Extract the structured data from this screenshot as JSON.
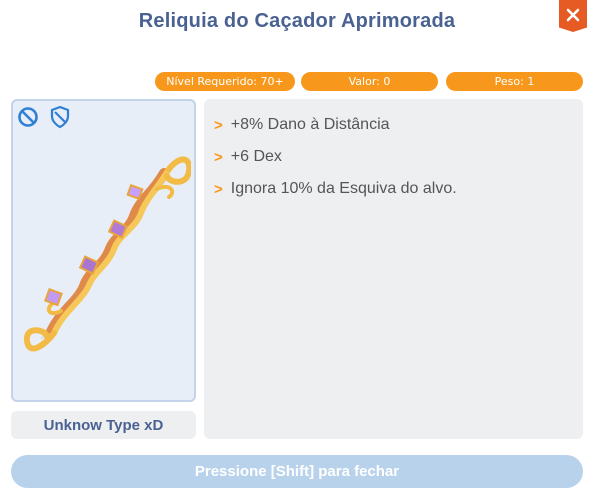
{
  "window": {
    "title": "Reliquia do Caçador Aprimorada",
    "close_icon": "close-icon"
  },
  "stats": {
    "required_level": "Nível Requerido: 70+",
    "value": "Valor: 0",
    "weight": "Peso: 1"
  },
  "item": {
    "image": "bow",
    "icons": [
      "no-trade-icon",
      "shield-icon"
    ],
    "type_label": "Unknow Type xD"
  },
  "description": {
    "lines": [
      {
        "bullet": ">",
        "text": "+8% Dano à Distância"
      },
      {
        "bullet": ">",
        "text": "+6 Dex"
      },
      {
        "bullet": ">",
        "text": "Ignora 10% da Esquiva do alvo."
      }
    ]
  },
  "footer": {
    "close_hint": "Pressione [Shift] para fechar"
  },
  "colors": {
    "title": "#4a6291",
    "accent": "#f7981d",
    "close": "#e65a23",
    "footer": "#b8d2ec"
  }
}
